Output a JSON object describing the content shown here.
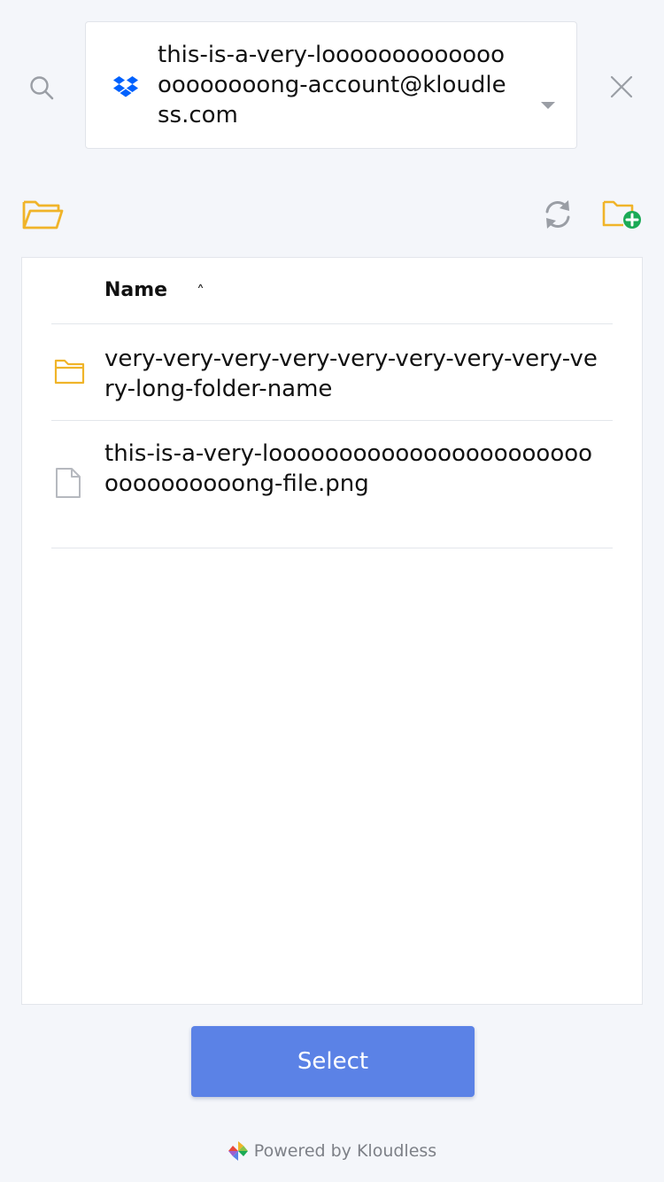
{
  "header": {
    "account": "this-is-a-very-looooooooooooooooooooong-account@kloudless.com",
    "account_service_icon": "dropbox-icon",
    "search_icon": "search-icon",
    "close_icon": "close-icon",
    "dropdown_icon": "chevron-down-icon"
  },
  "toolbar": {
    "open_folder_icon": "folder-open-icon",
    "refresh_icon": "refresh-icon",
    "new_folder_icon": "folder-add-icon"
  },
  "file_list": {
    "column_header": "Name",
    "sort_indicator": "˄",
    "items": [
      {
        "type": "folder",
        "icon": "folder-icon",
        "name": "very-very-very-very-very-very-very-very-very-long-folder-name"
      },
      {
        "type": "file",
        "icon": "file-icon",
        "name": "this-is-a-very-looooooooooooooooooooooooooooooooong-file.png"
      }
    ]
  },
  "select_button": {
    "label": "Select"
  },
  "footer": {
    "text": "Powered by Kloudless",
    "logo": "kloudless-logo"
  },
  "colors": {
    "accent": "#5b82e6",
    "background": "#f4f6fa",
    "folder": "#f0b429",
    "new_folder_plus": "#1aaa55",
    "dropbox": "#0061fe"
  }
}
